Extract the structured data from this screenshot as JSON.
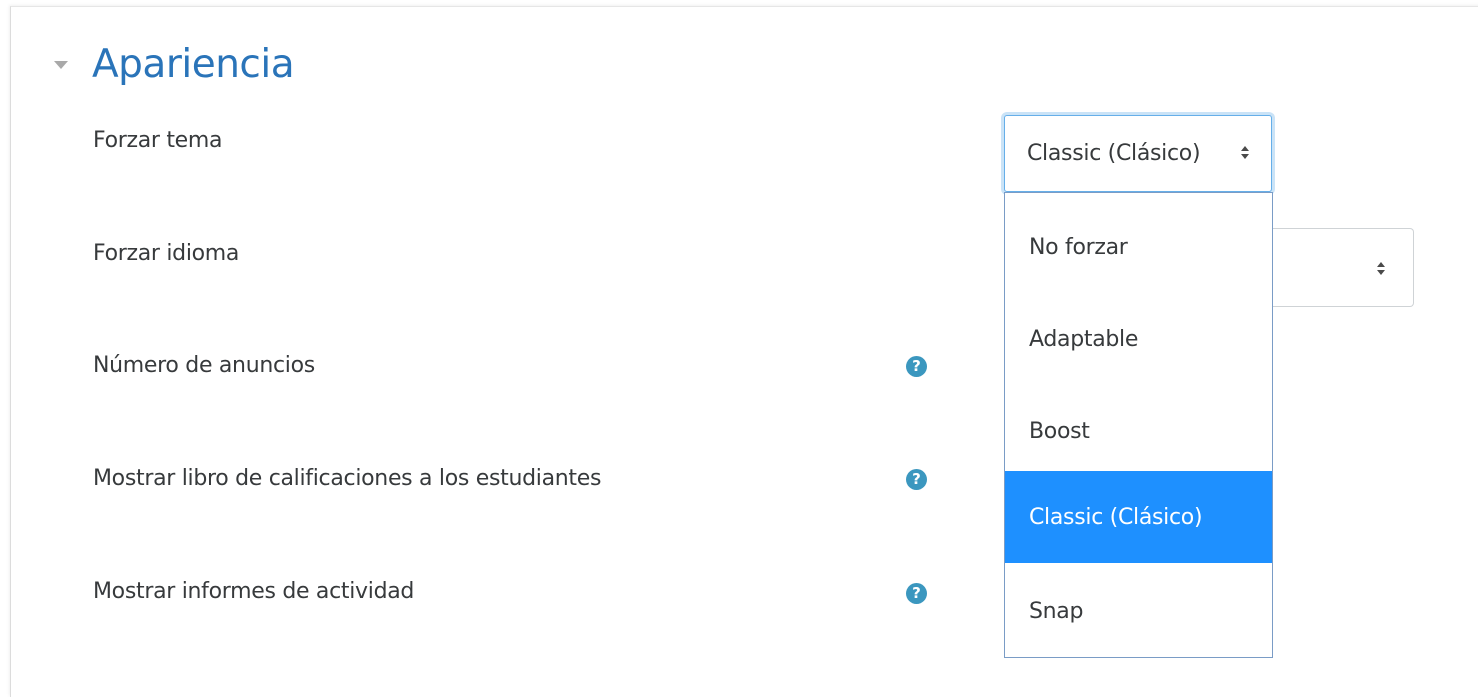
{
  "section": {
    "title": "Apariencia",
    "toggle_icon": "caret-down-icon"
  },
  "fields": {
    "force_theme": {
      "label": "Forzar tema",
      "selected_value": "Classic (Clásico)"
    },
    "force_language": {
      "label": "Forzar idioma"
    },
    "news_items": {
      "label": "Número de anuncios",
      "help_icon": "?"
    },
    "show_grades": {
      "label": "Mostrar libro de calificaciones a los estudiantes",
      "help_icon": "?"
    },
    "show_reports": {
      "label": "Mostrar informes de actividad",
      "help_icon": "?"
    }
  },
  "theme_dropdown": {
    "options": [
      {
        "label": "No forzar",
        "selected": false
      },
      {
        "label": "Adaptable",
        "selected": false
      },
      {
        "label": "Boost",
        "selected": false
      },
      {
        "label": "Classic (Clásico)",
        "selected": true
      },
      {
        "label": "Snap",
        "selected": false
      }
    ]
  },
  "colors": {
    "title": "#2a74b9",
    "help_icon": "#3b97bf",
    "selected_option": "#1e90ff",
    "focus_border": "#66afe9"
  }
}
